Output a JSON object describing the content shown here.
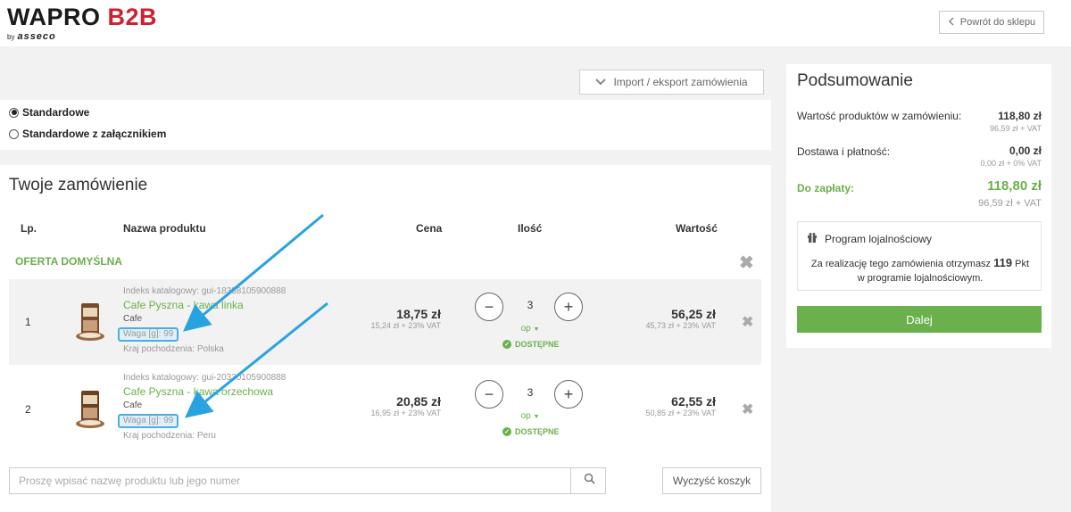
{
  "logo": {
    "main_part1": "WAPRO",
    "main_part2": "B2B",
    "by": "by",
    "vendor": "asseco"
  },
  "header": {
    "back_label": "Powrót do sklepu"
  },
  "import": {
    "label": "Import / eksport zamówienia"
  },
  "order_type": {
    "options": [
      {
        "label": "Standardowe",
        "checked": true
      },
      {
        "label": "Standardowe z załącznikiem",
        "checked": false
      }
    ]
  },
  "order": {
    "title": "Twoje zamówienie",
    "columns": {
      "lp": "Lp.",
      "name": "Nazwa produktu",
      "price": "Cena",
      "qty": "Ilość",
      "value": "Wartość"
    },
    "offer_label": "OFERTA DOMYŚLNA",
    "items": [
      {
        "lp": "1",
        "catalog": "Indeks katalogowy: gui-18338105900888",
        "name": "Cafe Pyszna - kawa linka",
        "category": "Cafe",
        "weight": "Waga [g]: 99",
        "origin": "Kraj pochodzenia: Polska",
        "price": "18,75 zł",
        "price_net": "15,24 zł + 23% VAT",
        "qty": "3",
        "unit": "op",
        "availability": "DOSTĘPNE",
        "value": "56,25 zł",
        "value_net": "45,73 zł + 23% VAT"
      },
      {
        "lp": "2",
        "catalog": "Indeks katalogowy: gui-20330105900888",
        "name": "Cafe Pyszna - kawa orzechowa",
        "category": "Cafe",
        "weight": "Waga [g]: 99",
        "origin": "Kraj pochodzenia: Peru",
        "price": "20,85 zł",
        "price_net": "16,95 zł + 23% VAT",
        "qty": "3",
        "unit": "op",
        "availability": "DOSTĘPNE",
        "value": "62,55 zł",
        "value_net": "50,85 zł + 23% VAT"
      }
    ],
    "search_placeholder": "Proszę wpisać nazwę produktu lub jego numer",
    "clear_label": "Wyczyść koszyk"
  },
  "summary": {
    "title": "Podsumowanie",
    "products_label": "Wartość produktów w zamówieniu:",
    "products_value": "118,80 zł",
    "products_net": "96,59 zł + VAT",
    "delivery_label": "Dostawa i płatność:",
    "delivery_value": "0,00 zł",
    "delivery_net": "0,00 zł + 0% VAT",
    "topay_label": "Do zapłaty:",
    "topay_value": "118,80 zł",
    "topay_net": "96,59 zł + VAT",
    "loyalty_title": "Program lojalnościowy",
    "loyalty_text_1": "Za realizację tego zamówienia otrzymasz",
    "loyalty_points": "119",
    "loyalty_unit": "Pkt",
    "loyalty_text_2": "w programie lojalnościowym.",
    "next_label": "Dalej"
  },
  "colors": {
    "accent_green": "#6ab04c",
    "brand_red": "#d0202f",
    "annotation_blue": "#29a3e0"
  }
}
